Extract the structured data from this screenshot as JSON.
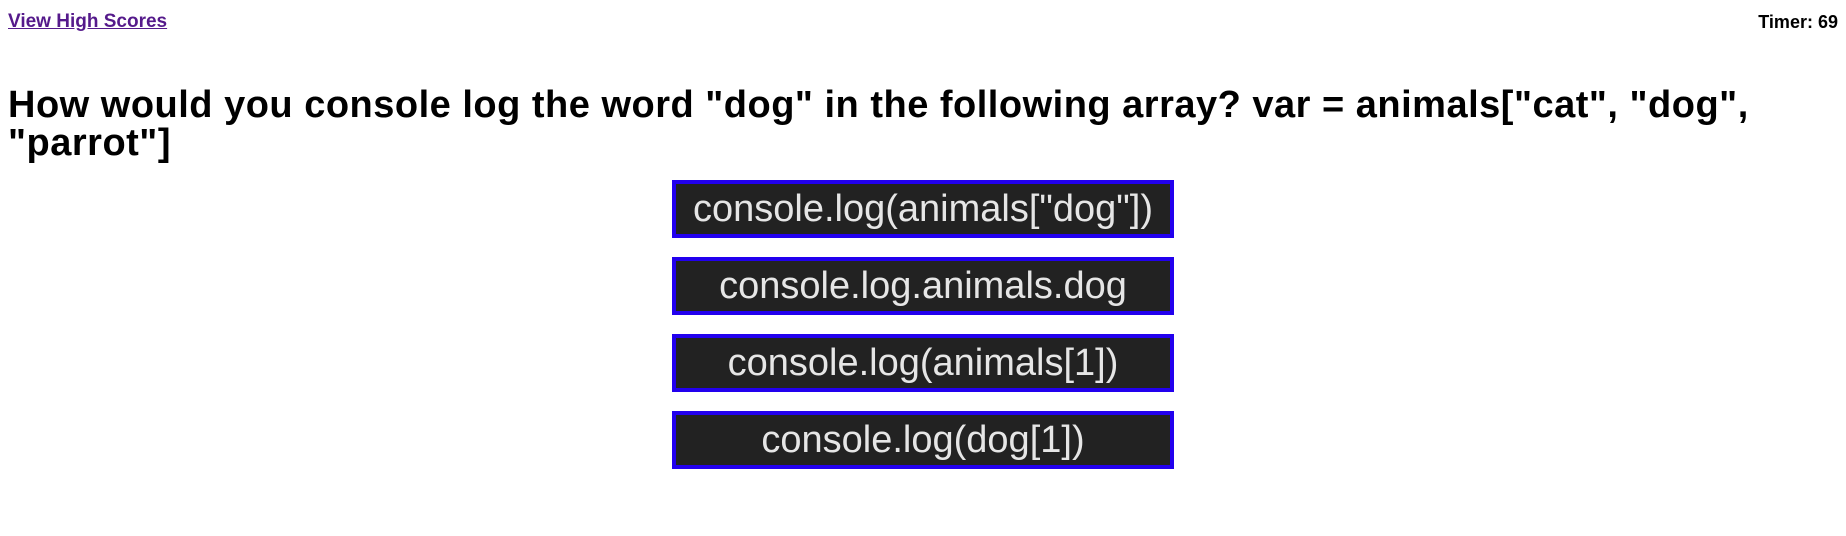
{
  "header": {
    "high_scores_link": "View High Scores",
    "timer_label": "Timer:",
    "timer_value": "69"
  },
  "question": {
    "text": "How would you console log the word \"dog\" in the following array? var = animals[\"cat\", \"dog\", \"parrot\"]"
  },
  "choices": [
    "console.log(animals[\"dog\"])",
    "console.log.animals.dog",
    "console.log(animals[1])",
    "console.log(dog[1])"
  ],
  "colors": {
    "link": "#551a8b",
    "button_bg": "#222222",
    "button_border": "#2200ee",
    "button_text": "#e6e6e6"
  }
}
